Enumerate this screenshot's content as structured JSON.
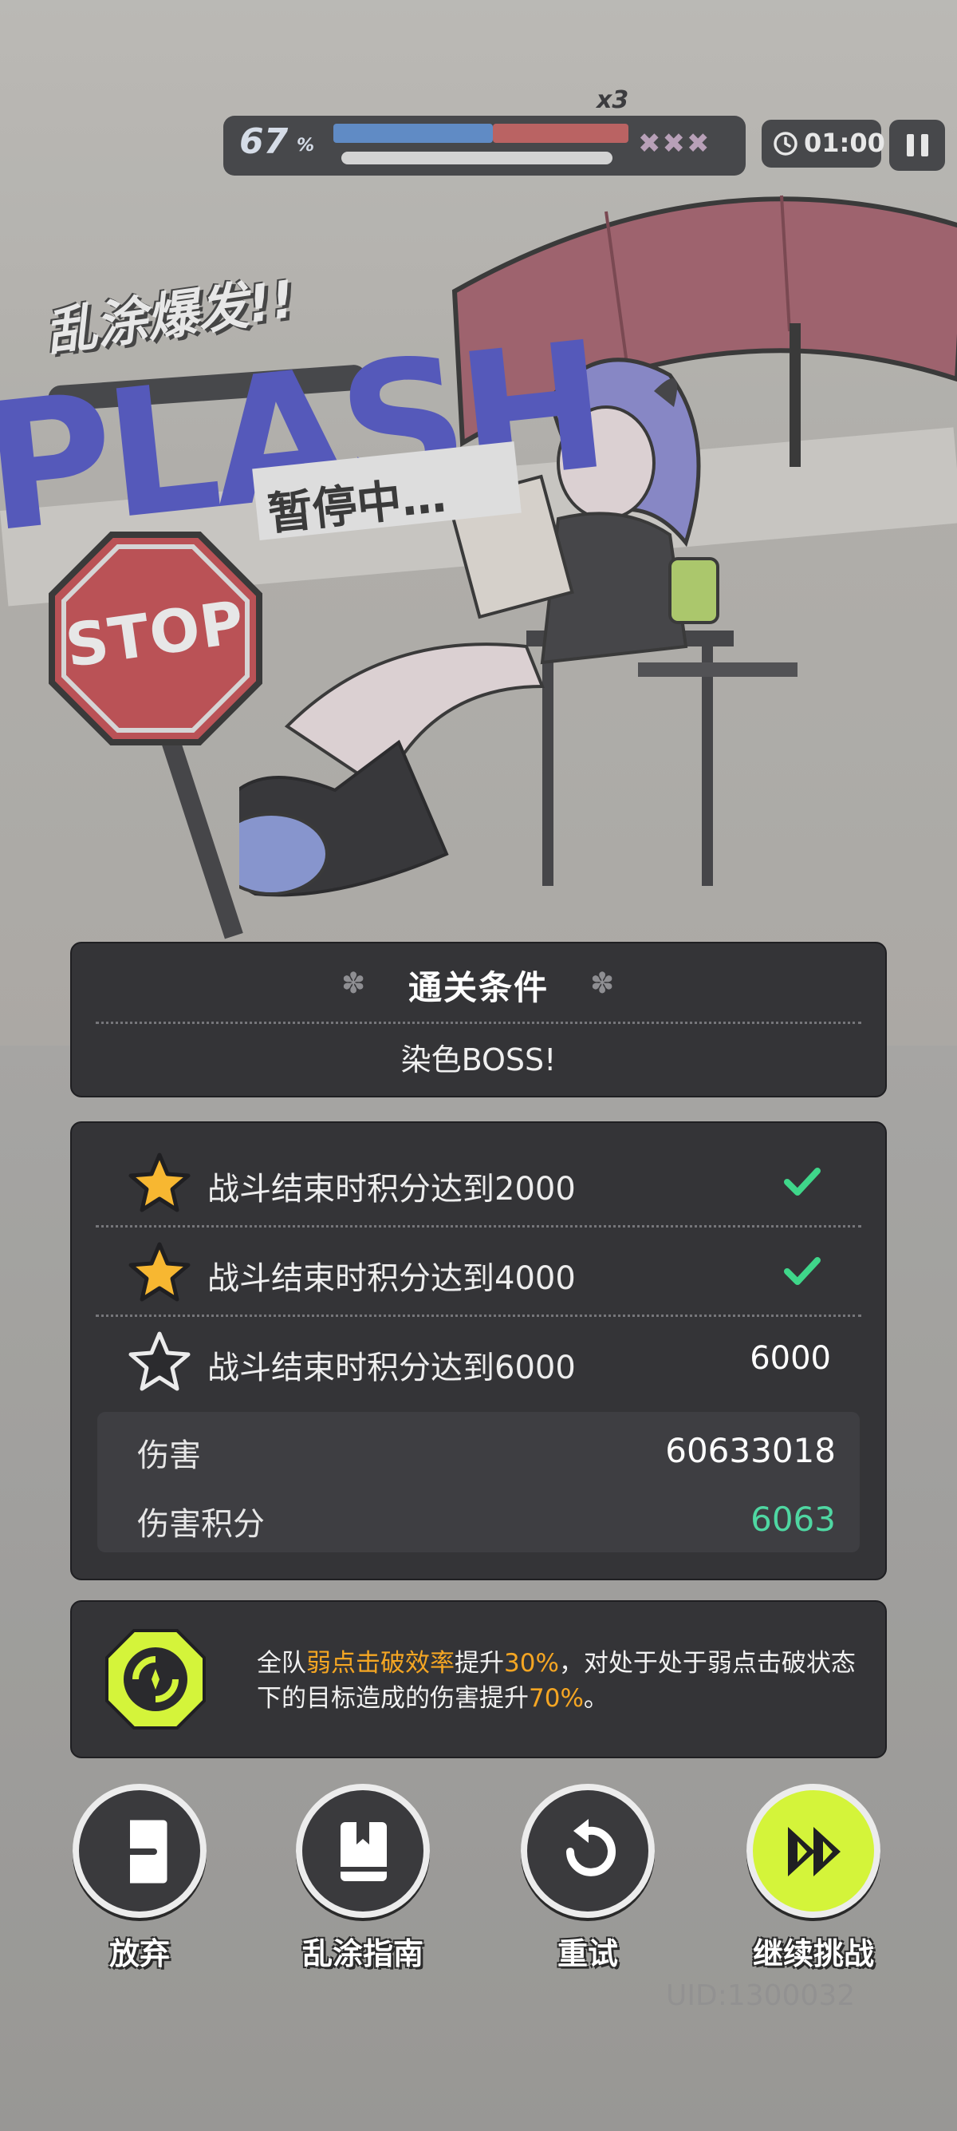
{
  "hud": {
    "progress_percent": "67",
    "percent_sign": "%",
    "multiplier": "x3",
    "timer": "01:00",
    "progress_fraction": 0.67
  },
  "scene": {
    "burst_text": "乱涂爆发!!",
    "splash_text": "PLASH",
    "paused_text": "暂停中…",
    "stop_sign": "STOP"
  },
  "conditions": {
    "title": "通关条件",
    "condition": "染色BOSS!"
  },
  "stars": [
    {
      "label": "战斗结束时积分达到2000",
      "achieved": true
    },
    {
      "label": "战斗结束时积分达到4000",
      "achieved": true
    },
    {
      "label": "战斗结束时积分达到6000",
      "achieved": false,
      "value": "6000"
    }
  ],
  "damage": {
    "label": "伤害",
    "value": "60633018",
    "score_label": "伤害积分",
    "score_value": "6063"
  },
  "buff": {
    "p1": "全队",
    "h1": "弱点击破效率",
    "p2": "提升",
    "h2": "30%",
    "p3": "，对处于处于弱点击破状态下的目标造成的伤害提升",
    "h3": "70%",
    "p4": "。"
  },
  "actions": {
    "give_up": "放弃",
    "guide": "乱涂指南",
    "retry": "重试",
    "continue": "继续挑战"
  },
  "uid": "UID:1300032",
  "colors": {
    "panel": "#343437",
    "accent_lime": "#d4f43a",
    "highlight": "#f5a623",
    "check": "#3fd68a",
    "score": "#4fd7a2",
    "star_gold": "#f7b731"
  }
}
